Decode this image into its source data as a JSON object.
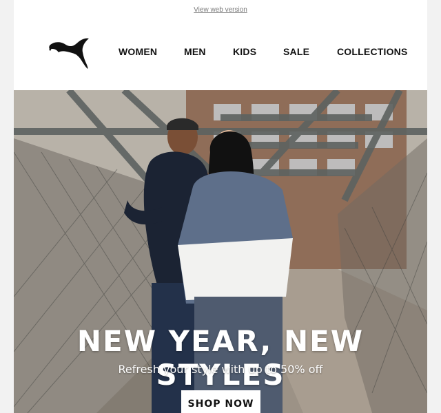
{
  "top_bar": {
    "web_version_link": "View web version"
  },
  "header": {
    "logo_icon": "puma-logo-icon",
    "nav": [
      {
        "label": "WOMEN"
      },
      {
        "label": "MEN"
      },
      {
        "label": "KIDS"
      },
      {
        "label": "SALE"
      },
      {
        "label": "COLLECTIONS"
      }
    ]
  },
  "hero": {
    "headline": "NEW YEAR, NEW STYLES",
    "subheadline": "Refresh your style with up to 50% off",
    "cta_label": "SHOP NOW"
  },
  "colors": {
    "text": "#111111",
    "background": "#ffffff",
    "page": "#f2f2f2",
    "cta_bg": "#ffffff"
  }
}
